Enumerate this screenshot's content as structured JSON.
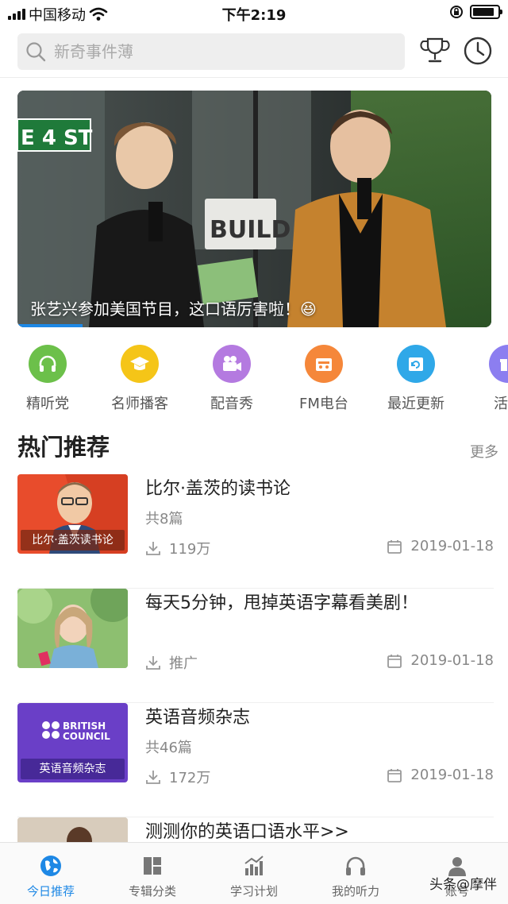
{
  "status_bar": {
    "carrier": "中国移动",
    "time": "下午2:19"
  },
  "search": {
    "placeholder": "新奇事件薄"
  },
  "banner": {
    "caption": "张艺兴参加美国节目，这口语厉害啦！😆",
    "sign_text": "E 4 ST",
    "build_text": "BUILD"
  },
  "categories": [
    {
      "label": "精听党",
      "icon": "headphones-icon",
      "color": "#6cc04a"
    },
    {
      "label": "名师播客",
      "icon": "graduation-cap-icon",
      "color": "#f5c518"
    },
    {
      "label": "配音秀",
      "icon": "video-camera-icon",
      "color": "#b47ae0"
    },
    {
      "label": "FM电台",
      "icon": "radio-icon",
      "color": "#f5873a"
    },
    {
      "label": "最近更新",
      "icon": "refresh-icon",
      "color": "#2fa8e8"
    },
    {
      "label": "活动",
      "icon": "gift-icon",
      "color": "#8c7ef0"
    }
  ],
  "section": {
    "title": "热门推荐",
    "more": "更多"
  },
  "items": [
    {
      "title": "比尔·盖茨的读书论",
      "count": "共8篇",
      "downloads": "119万",
      "date": "2019-01-18",
      "thumb_label": "比尔·盖茨读书论"
    },
    {
      "title": "每天5分钟，甩掉英语字幕看美剧！",
      "count": "",
      "downloads": "推广",
      "date": "2019-01-18",
      "thumb_label": ""
    },
    {
      "title": "英语音频杂志",
      "count": "共46篇",
      "downloads": "172万",
      "date": "2019-01-18",
      "thumb_label": "英语音频杂志",
      "thumb_brand": [
        "BRITISH",
        "COUNCIL"
      ]
    },
    {
      "title": "测测你的英语口语水平>>",
      "count": "",
      "downloads": "",
      "date": "",
      "thumb_label": ""
    }
  ],
  "tabs": [
    {
      "label": "今日推荐",
      "icon": "globe-icon",
      "active": true
    },
    {
      "label": "专辑分类",
      "icon": "grid-icon",
      "active": false
    },
    {
      "label": "学习计划",
      "icon": "chart-icon",
      "active": false
    },
    {
      "label": "我的听力",
      "icon": "headphones-icon",
      "active": false
    },
    {
      "label": "账号",
      "icon": "user-icon",
      "active": false
    }
  ],
  "watermark": "头条@摩伴",
  "colors": {
    "accent": "#1e88e5",
    "search_bg": "#eeeeee"
  }
}
